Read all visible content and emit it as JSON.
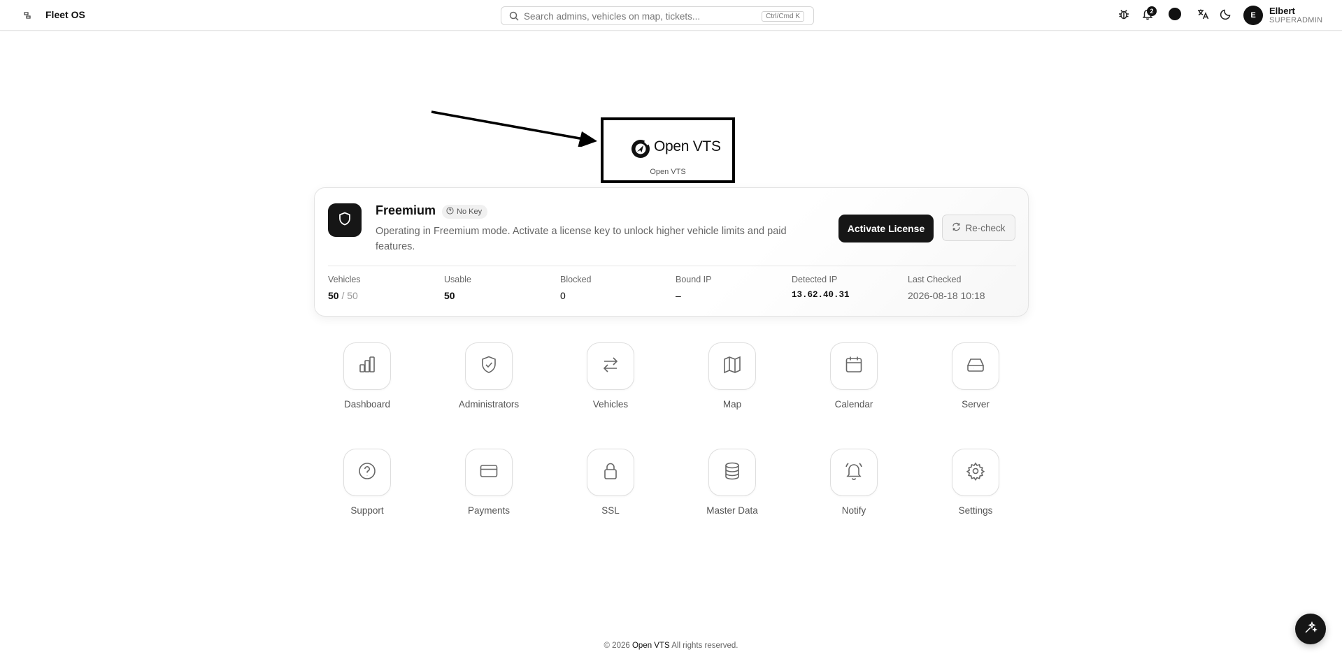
{
  "header": {
    "app_title": "Fleet OS",
    "search": {
      "placeholder": "Search admins, vehicles on map, tickets...",
      "shortcut": "Ctrl/Cmd K"
    },
    "notifications_count": "2",
    "user": {
      "initial": "E",
      "name": "Elbert",
      "role": "SUPERADMIN"
    },
    "icons": [
      "sidebar-toggle-icon",
      "bug-icon",
      "bell-icon",
      "theme-color-icon",
      "language-icon",
      "moon-icon"
    ]
  },
  "logo": {
    "name": "Open VTS",
    "caption": "Open VTS"
  },
  "license": {
    "plan": "Freemium",
    "key_status": "No Key",
    "description": "Operating in Freemium mode. Activate a license key to unlock higher vehicle limits and paid features.",
    "activate_label": "Activate License",
    "recheck_label": "Re-check",
    "stats": {
      "vehicles": {
        "label": "Vehicles",
        "used": "50",
        "limit": "/ 50"
      },
      "usable": {
        "label": "Usable",
        "value": "50"
      },
      "blocked": {
        "label": "Blocked",
        "value": "0"
      },
      "bound_ip": {
        "label": "Bound IP",
        "value": "–"
      },
      "detected_ip": {
        "label": "Detected IP",
        "value": "13.62.40.31"
      },
      "last_checked": {
        "label": "Last Checked",
        "value": "2026-08-18 10:18"
      }
    }
  },
  "apps": [
    {
      "label": "Dashboard",
      "icon": "bar-chart-icon"
    },
    {
      "label": "Administrators",
      "icon": "shield-check-icon"
    },
    {
      "label": "Vehicles",
      "icon": "swap-arrows-icon"
    },
    {
      "label": "Map",
      "icon": "map-icon"
    },
    {
      "label": "Calendar",
      "icon": "calendar-icon"
    },
    {
      "label": "Server",
      "icon": "hard-drive-icon"
    },
    {
      "label": "Support",
      "icon": "help-circle-icon"
    },
    {
      "label": "Payments",
      "icon": "credit-card-icon"
    },
    {
      "label": "SSL",
      "icon": "lock-icon"
    },
    {
      "label": "Master Data",
      "icon": "database-icon"
    },
    {
      "label": "Notify",
      "icon": "bell-ring-icon"
    },
    {
      "label": "Settings",
      "icon": "gear-icon"
    }
  ],
  "footer": {
    "prefix": "© 2026",
    "brand": "Open VTS",
    "suffix": "All rights reserved."
  },
  "colors": {
    "primary": "#161616",
    "muted_text": "#666666",
    "border": "#dedede"
  }
}
